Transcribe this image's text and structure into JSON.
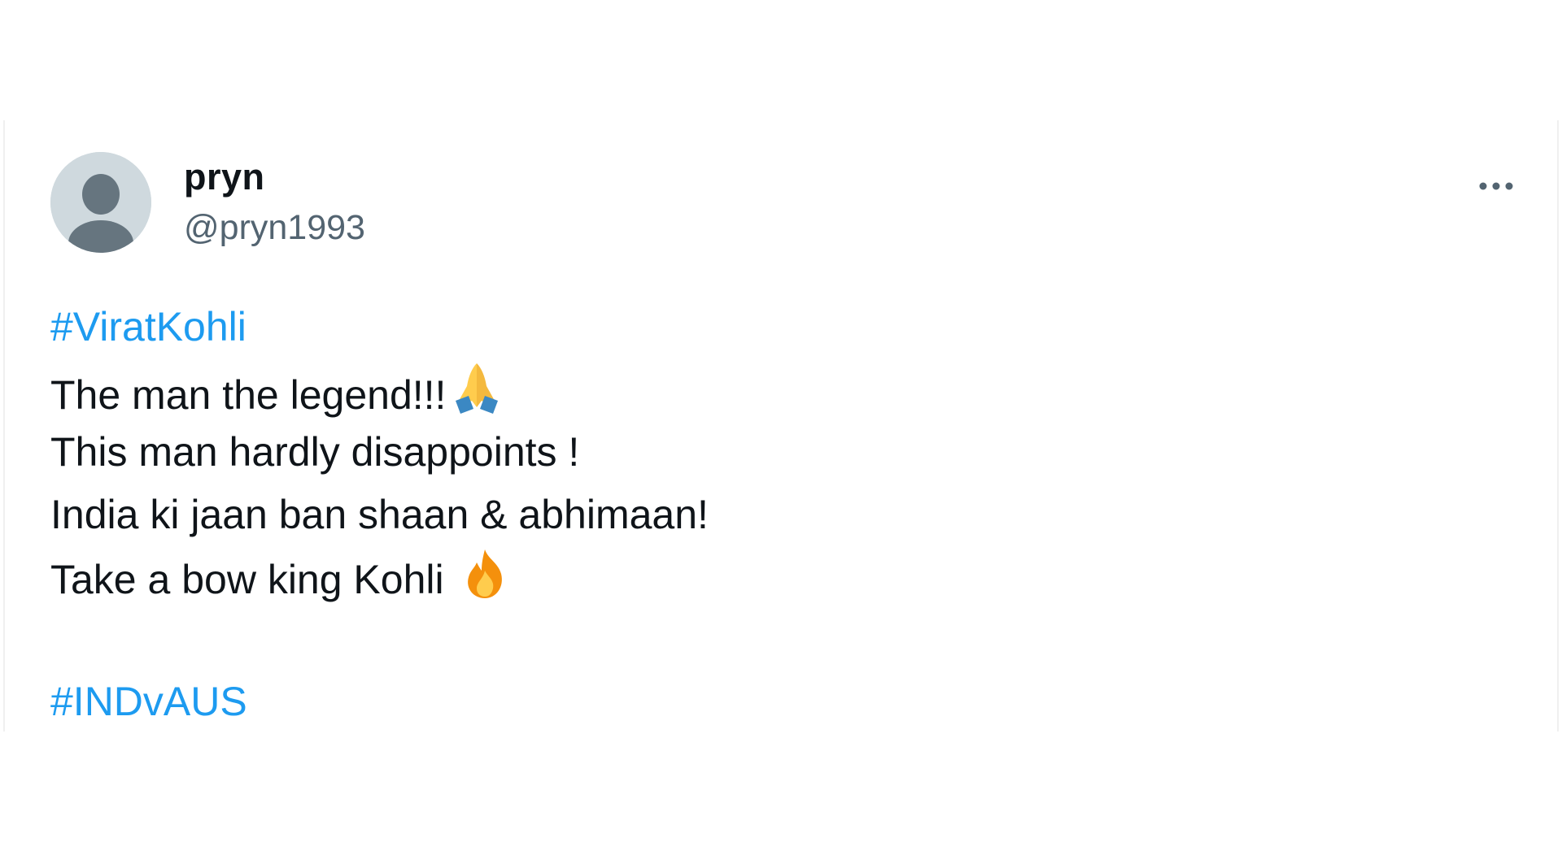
{
  "tweet": {
    "author": {
      "name": "pryn",
      "handle": "@pryn1993",
      "avatar_icon": "default-avatar-icon"
    },
    "more_icon": "more-dots-icon",
    "lines": {
      "hashtag_1": "#ViratKohli",
      "line_1": "The man the legend!!!",
      "line_1_emoji": "folded-hands-icon",
      "line_2": "This man hardly disappoints !",
      "line_3": "India ki jaan ban shaan & abhimaan!",
      "line_4": "Take a bow king Kohli ",
      "line_4_emoji": "fire-icon",
      "hashtag_2": "#INDvAUS"
    }
  },
  "colors": {
    "hashtag": "#1d9bf0",
    "text": "#0f1419",
    "secondary": "#536471",
    "avatar_bg": "#cfd9de"
  }
}
